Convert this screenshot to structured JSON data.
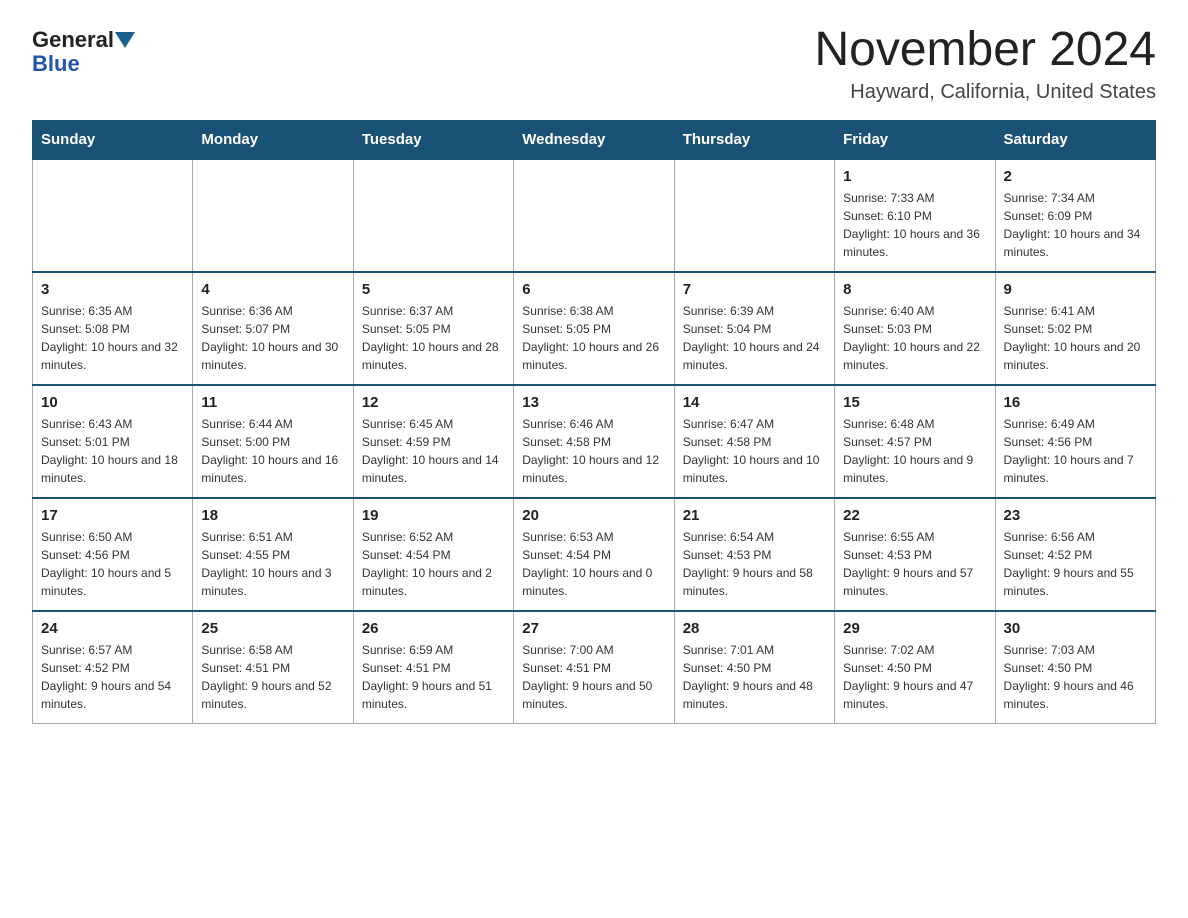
{
  "header": {
    "logo_general": "General",
    "logo_blue": "Blue",
    "title": "November 2024",
    "subtitle": "Hayward, California, United States"
  },
  "weekdays": [
    "Sunday",
    "Monday",
    "Tuesday",
    "Wednesday",
    "Thursday",
    "Friday",
    "Saturday"
  ],
  "weeks": [
    [
      {
        "day": "",
        "sunrise": "",
        "sunset": "",
        "daylight": ""
      },
      {
        "day": "",
        "sunrise": "",
        "sunset": "",
        "daylight": ""
      },
      {
        "day": "",
        "sunrise": "",
        "sunset": "",
        "daylight": ""
      },
      {
        "day": "",
        "sunrise": "",
        "sunset": "",
        "daylight": ""
      },
      {
        "day": "",
        "sunrise": "",
        "sunset": "",
        "daylight": ""
      },
      {
        "day": "1",
        "sunrise": "Sunrise: 7:33 AM",
        "sunset": "Sunset: 6:10 PM",
        "daylight": "Daylight: 10 hours and 36 minutes."
      },
      {
        "day": "2",
        "sunrise": "Sunrise: 7:34 AM",
        "sunset": "Sunset: 6:09 PM",
        "daylight": "Daylight: 10 hours and 34 minutes."
      }
    ],
    [
      {
        "day": "3",
        "sunrise": "Sunrise: 6:35 AM",
        "sunset": "Sunset: 5:08 PM",
        "daylight": "Daylight: 10 hours and 32 minutes."
      },
      {
        "day": "4",
        "sunrise": "Sunrise: 6:36 AM",
        "sunset": "Sunset: 5:07 PM",
        "daylight": "Daylight: 10 hours and 30 minutes."
      },
      {
        "day": "5",
        "sunrise": "Sunrise: 6:37 AM",
        "sunset": "Sunset: 5:05 PM",
        "daylight": "Daylight: 10 hours and 28 minutes."
      },
      {
        "day": "6",
        "sunrise": "Sunrise: 6:38 AM",
        "sunset": "Sunset: 5:05 PM",
        "daylight": "Daylight: 10 hours and 26 minutes."
      },
      {
        "day": "7",
        "sunrise": "Sunrise: 6:39 AM",
        "sunset": "Sunset: 5:04 PM",
        "daylight": "Daylight: 10 hours and 24 minutes."
      },
      {
        "day": "8",
        "sunrise": "Sunrise: 6:40 AM",
        "sunset": "Sunset: 5:03 PM",
        "daylight": "Daylight: 10 hours and 22 minutes."
      },
      {
        "day": "9",
        "sunrise": "Sunrise: 6:41 AM",
        "sunset": "Sunset: 5:02 PM",
        "daylight": "Daylight: 10 hours and 20 minutes."
      }
    ],
    [
      {
        "day": "10",
        "sunrise": "Sunrise: 6:43 AM",
        "sunset": "Sunset: 5:01 PM",
        "daylight": "Daylight: 10 hours and 18 minutes."
      },
      {
        "day": "11",
        "sunrise": "Sunrise: 6:44 AM",
        "sunset": "Sunset: 5:00 PM",
        "daylight": "Daylight: 10 hours and 16 minutes."
      },
      {
        "day": "12",
        "sunrise": "Sunrise: 6:45 AM",
        "sunset": "Sunset: 4:59 PM",
        "daylight": "Daylight: 10 hours and 14 minutes."
      },
      {
        "day": "13",
        "sunrise": "Sunrise: 6:46 AM",
        "sunset": "Sunset: 4:58 PM",
        "daylight": "Daylight: 10 hours and 12 minutes."
      },
      {
        "day": "14",
        "sunrise": "Sunrise: 6:47 AM",
        "sunset": "Sunset: 4:58 PM",
        "daylight": "Daylight: 10 hours and 10 minutes."
      },
      {
        "day": "15",
        "sunrise": "Sunrise: 6:48 AM",
        "sunset": "Sunset: 4:57 PM",
        "daylight": "Daylight: 10 hours and 9 minutes."
      },
      {
        "day": "16",
        "sunrise": "Sunrise: 6:49 AM",
        "sunset": "Sunset: 4:56 PM",
        "daylight": "Daylight: 10 hours and 7 minutes."
      }
    ],
    [
      {
        "day": "17",
        "sunrise": "Sunrise: 6:50 AM",
        "sunset": "Sunset: 4:56 PM",
        "daylight": "Daylight: 10 hours and 5 minutes."
      },
      {
        "day": "18",
        "sunrise": "Sunrise: 6:51 AM",
        "sunset": "Sunset: 4:55 PM",
        "daylight": "Daylight: 10 hours and 3 minutes."
      },
      {
        "day": "19",
        "sunrise": "Sunrise: 6:52 AM",
        "sunset": "Sunset: 4:54 PM",
        "daylight": "Daylight: 10 hours and 2 minutes."
      },
      {
        "day": "20",
        "sunrise": "Sunrise: 6:53 AM",
        "sunset": "Sunset: 4:54 PM",
        "daylight": "Daylight: 10 hours and 0 minutes."
      },
      {
        "day": "21",
        "sunrise": "Sunrise: 6:54 AM",
        "sunset": "Sunset: 4:53 PM",
        "daylight": "Daylight: 9 hours and 58 minutes."
      },
      {
        "day": "22",
        "sunrise": "Sunrise: 6:55 AM",
        "sunset": "Sunset: 4:53 PM",
        "daylight": "Daylight: 9 hours and 57 minutes."
      },
      {
        "day": "23",
        "sunrise": "Sunrise: 6:56 AM",
        "sunset": "Sunset: 4:52 PM",
        "daylight": "Daylight: 9 hours and 55 minutes."
      }
    ],
    [
      {
        "day": "24",
        "sunrise": "Sunrise: 6:57 AM",
        "sunset": "Sunset: 4:52 PM",
        "daylight": "Daylight: 9 hours and 54 minutes."
      },
      {
        "day": "25",
        "sunrise": "Sunrise: 6:58 AM",
        "sunset": "Sunset: 4:51 PM",
        "daylight": "Daylight: 9 hours and 52 minutes."
      },
      {
        "day": "26",
        "sunrise": "Sunrise: 6:59 AM",
        "sunset": "Sunset: 4:51 PM",
        "daylight": "Daylight: 9 hours and 51 minutes."
      },
      {
        "day": "27",
        "sunrise": "Sunrise: 7:00 AM",
        "sunset": "Sunset: 4:51 PM",
        "daylight": "Daylight: 9 hours and 50 minutes."
      },
      {
        "day": "28",
        "sunrise": "Sunrise: 7:01 AM",
        "sunset": "Sunset: 4:50 PM",
        "daylight": "Daylight: 9 hours and 48 minutes."
      },
      {
        "day": "29",
        "sunrise": "Sunrise: 7:02 AM",
        "sunset": "Sunset: 4:50 PM",
        "daylight": "Daylight: 9 hours and 47 minutes."
      },
      {
        "day": "30",
        "sunrise": "Sunrise: 7:03 AM",
        "sunset": "Sunset: 4:50 PM",
        "daylight": "Daylight: 9 hours and 46 minutes."
      }
    ]
  ]
}
